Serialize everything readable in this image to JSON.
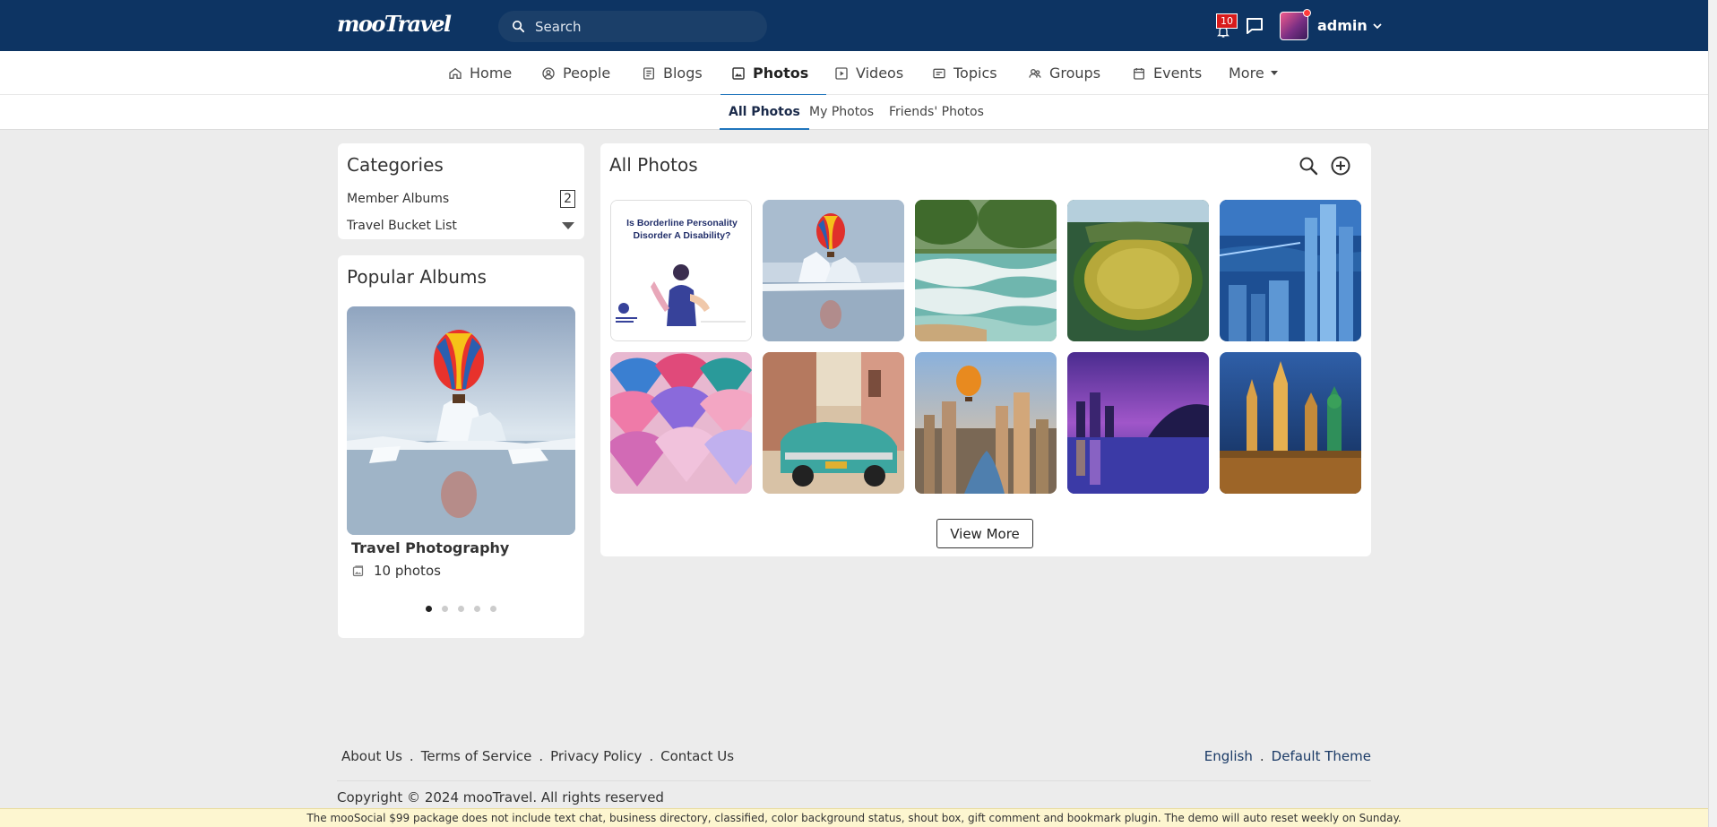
{
  "header": {
    "logo": "mooTravel",
    "search_placeholder": "Search",
    "notification_count": "10",
    "user_name": "admin"
  },
  "main_nav": [
    {
      "label": "Home",
      "icon": "home-icon"
    },
    {
      "label": "People",
      "icon": "people-icon"
    },
    {
      "label": "Blogs",
      "icon": "blogs-icon"
    },
    {
      "label": "Photos",
      "icon": "photos-icon",
      "active": true
    },
    {
      "label": "Videos",
      "icon": "videos-icon"
    },
    {
      "label": "Topics",
      "icon": "topics-icon"
    },
    {
      "label": "Groups",
      "icon": "groups-icon"
    },
    {
      "label": "Events",
      "icon": "events-icon"
    },
    {
      "label": "More",
      "icon": "caret-down-icon"
    }
  ],
  "sub_nav": [
    {
      "label": "All Photos",
      "active": true
    },
    {
      "label": "My Photos"
    },
    {
      "label": "Friends' Photos"
    }
  ],
  "categories": {
    "title": "Categories",
    "items": [
      {
        "label": "Member Albums",
        "count": "2"
      },
      {
        "label": "Travel Bucket List"
      }
    ]
  },
  "popular_albums": {
    "title": "Popular Albums",
    "album_name": "Travel Photography",
    "album_count": "10 photos"
  },
  "all_photos": {
    "title": "All Photos",
    "poster_line1": "Is Borderline Personality",
    "poster_line2": "Disorder A Disability?",
    "view_more": "View More"
  },
  "footer": {
    "links": [
      "About Us",
      "Terms of Service",
      "Privacy Policy",
      "Contact Us"
    ],
    "language": "English",
    "theme": "Default Theme",
    "copyright": "Copyright © 2024 mooTravel. All rights reserved",
    "notice": "The mooSocial $99 package does not include text chat, business directory, classified, color background status, shout box, gift comment and bookmark plugin. The demo will auto reset weekly on Sunday."
  },
  "colors": {
    "header_bg": "#0d3463",
    "accent": "#1f75bc",
    "page_bg": "#ececec",
    "badge": "#d91b1b"
  }
}
